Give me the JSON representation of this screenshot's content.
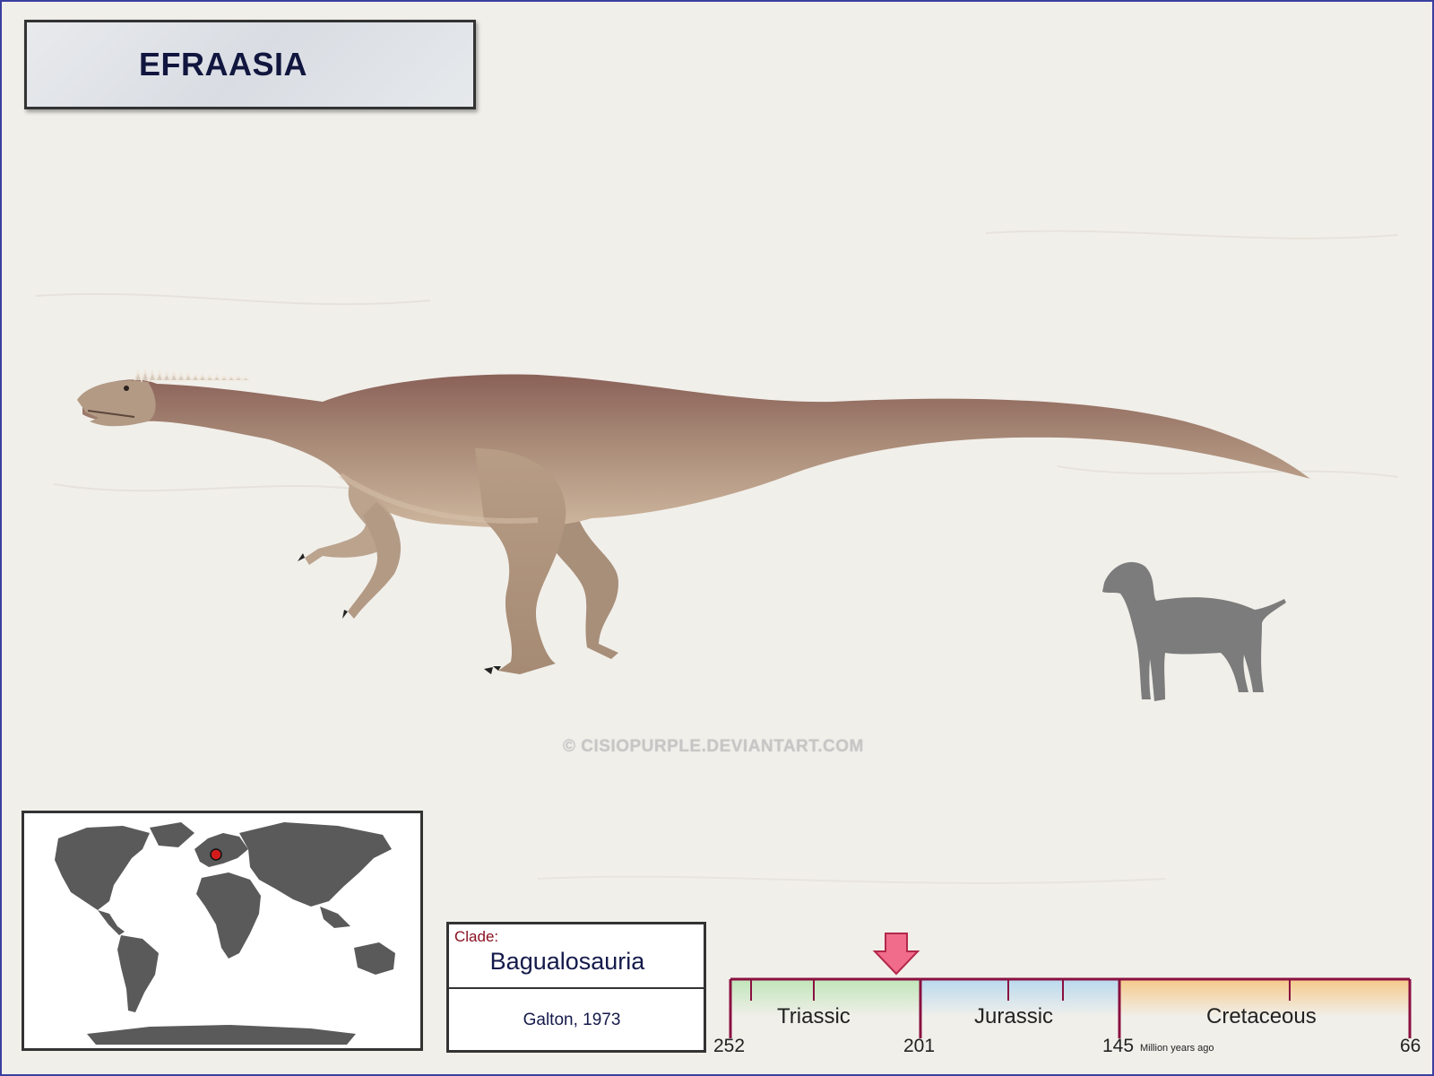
{
  "header": {
    "title": "EFRAASIA"
  },
  "watermark": "© CISIOPURPLE.DEVIANTART.COM",
  "icons": {
    "dinosaur": "dinosaur-illustration-icon",
    "scale": "dog-silhouette-icon",
    "map": "world-map-icon",
    "location": "location-marker-icon",
    "era": "arrow-down-icon"
  },
  "clade": {
    "label": "Clade:",
    "name": "Bagualosauria",
    "author": "Galton, 1973"
  },
  "timeline": {
    "periods": [
      {
        "name": "Triassic",
        "start": 252,
        "end": 201,
        "color": "#bfe6b8"
      },
      {
        "name": "Jurassic",
        "start": 201,
        "end": 145,
        "color": "#b9d9ee"
      },
      {
        "name": "Cretaceous",
        "start": 145,
        "end": 66,
        "color": "#f5c98a"
      }
    ],
    "ticks": [
      "252",
      "201",
      "145",
      "66"
    ],
    "unit": "Million years ago",
    "marker_color": "#f06c8a"
  },
  "colors": {
    "accent": "#8a1040",
    "title": "#11163f",
    "location": "#d21c1c"
  }
}
